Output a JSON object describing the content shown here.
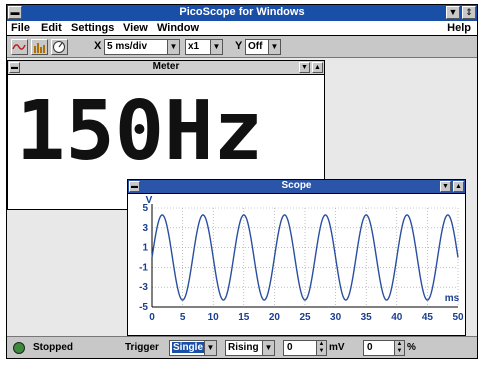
{
  "window": {
    "title": "PicoScope for Windows",
    "sys_menu": "▬",
    "minimize": "▼",
    "restore": "⇕"
  },
  "menu": {
    "file": "File",
    "edit": "Edit",
    "settings": "Settings",
    "view": "View",
    "window": "Window",
    "help": "Help"
  },
  "toolbar": {
    "x_label": "X",
    "timebase": "5 ms/div",
    "multiplier": "x1",
    "y_label": "Y",
    "y_value": "Off",
    "arrow": "▼"
  },
  "meter": {
    "title": "Meter",
    "reading": "150Hz"
  },
  "scope": {
    "title": "Scope",
    "y_unit": "V",
    "x_unit": "ms"
  },
  "status": {
    "state": "Stopped",
    "trigger_label": "Trigger",
    "trigger_mode": "Single",
    "trigger_edge": "Rising",
    "threshold": "0",
    "threshold_unit": "mV",
    "delay": "0",
    "delay_unit": "%"
  },
  "chart_data": {
    "type": "line",
    "xlabel": "ms",
    "ylabel": "V",
    "xlim": [
      0,
      50
    ],
    "ylim": [
      -5,
      5
    ],
    "x_ticks": [
      0,
      5,
      10,
      15,
      20,
      25,
      30,
      35,
      40,
      45,
      50
    ],
    "y_ticks": [
      5,
      3,
      1,
      -1,
      -3,
      -5
    ],
    "grid": true,
    "series": [
      {
        "amplitude": 4.3,
        "frequency_hz": 150,
        "x": [
          0,
          1.5,
          3.2,
          4.8,
          6.5,
          8.2,
          9.8,
          11.5,
          13.2,
          14.8,
          16.5,
          18.2,
          19.8,
          21.5,
          23.2,
          24.8,
          26.5,
          28.2,
          29.8,
          31.5,
          33.2,
          34.8,
          36.5,
          38.2,
          39.8,
          41.5,
          43.2,
          44.8,
          46.5,
          48.2,
          49.8
        ],
        "y": [
          0,
          4.3,
          0,
          -4.3,
          0,
          4.3,
          0,
          -4.3,
          0,
          4.3,
          0,
          -4.3,
          0,
          4.3,
          0,
          -4.3,
          0,
          4.3,
          0,
          -4.3,
          0,
          4.3,
          0,
          -4.3,
          0,
          4.3,
          0,
          -4.3,
          0,
          4.3,
          0
        ]
      }
    ],
    "colors": {
      "trace": "#2a4fa0",
      "grid": "#9a9a9a"
    }
  }
}
